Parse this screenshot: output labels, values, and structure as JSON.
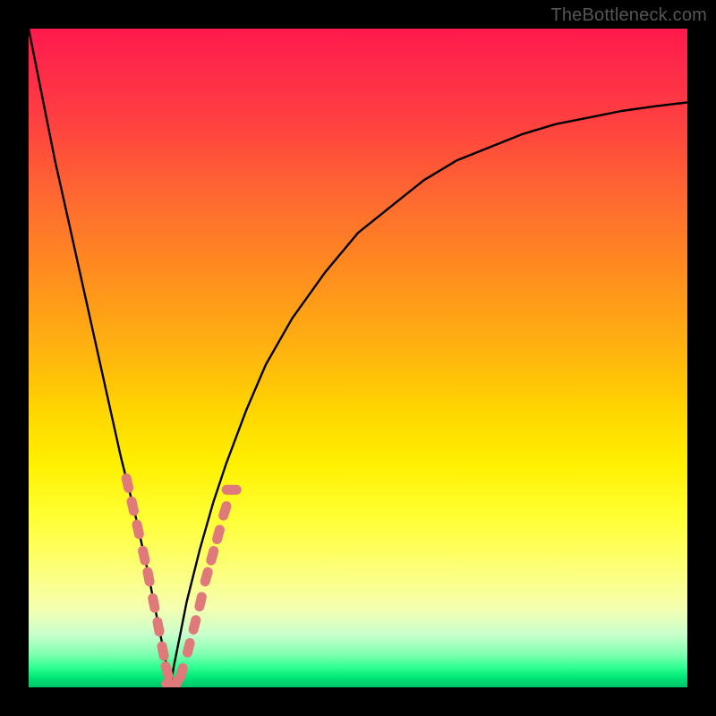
{
  "domain": "Chart",
  "watermark": "TheBottleneck.com",
  "colors": {
    "frame": "#000000",
    "curve_stroke": "#000000",
    "marker_fill": "#e07a7a",
    "gradient_stops": [
      "#ff1a4c",
      "#ff2a4a",
      "#ff4040",
      "#ff6a30",
      "#ff8a20",
      "#ffb010",
      "#ffd500",
      "#fff000",
      "#ffff33",
      "#ffff66",
      "#f5ffb0",
      "#c8ffcc",
      "#7fffb0",
      "#2dff8f",
      "#00e676",
      "#00c46a"
    ]
  },
  "chart_data": {
    "type": "line",
    "title": "",
    "xlabel": "",
    "ylabel": "",
    "xlim": [
      0,
      1
    ],
    "ylim": [
      0,
      1
    ],
    "note": "Values are normalized screen fractions (0..1). y represents the curve height from bottom; the visual color gradient encodes the same scalar (red high, green low). The minimum is at x≈0.215.",
    "series": [
      {
        "name": "bottleneck-curve",
        "x": [
          0.0,
          0.02,
          0.04,
          0.06,
          0.08,
          0.1,
          0.12,
          0.14,
          0.16,
          0.18,
          0.19,
          0.2,
          0.21,
          0.215,
          0.22,
          0.23,
          0.24,
          0.26,
          0.28,
          0.3,
          0.33,
          0.36,
          0.4,
          0.45,
          0.5,
          0.55,
          0.6,
          0.65,
          0.7,
          0.75,
          0.8,
          0.85,
          0.9,
          0.95,
          1.0
        ],
        "y": [
          1.0,
          0.9,
          0.8,
          0.71,
          0.62,
          0.53,
          0.44,
          0.35,
          0.27,
          0.18,
          0.13,
          0.08,
          0.03,
          0.0,
          0.03,
          0.08,
          0.13,
          0.21,
          0.28,
          0.34,
          0.42,
          0.49,
          0.56,
          0.63,
          0.69,
          0.73,
          0.77,
          0.8,
          0.82,
          0.84,
          0.855,
          0.865,
          0.875,
          0.882,
          0.888
        ]
      }
    ],
    "markers": {
      "name": "highlighted-points",
      "note": "Salmon pill-shaped markers clustered around the minimum on both branches.",
      "points": [
        {
          "x": 0.15,
          "y": 0.31
        },
        {
          "x": 0.158,
          "y": 0.275
        },
        {
          "x": 0.166,
          "y": 0.24
        },
        {
          "x": 0.175,
          "y": 0.2
        },
        {
          "x": 0.182,
          "y": 0.168
        },
        {
          "x": 0.19,
          "y": 0.128
        },
        {
          "x": 0.197,
          "y": 0.092
        },
        {
          "x": 0.204,
          "y": 0.055
        },
        {
          "x": 0.21,
          "y": 0.025
        },
        {
          "x": 0.216,
          "y": 0.005
        },
        {
          "x": 0.224,
          "y": 0.005
        },
        {
          "x": 0.232,
          "y": 0.022
        },
        {
          "x": 0.243,
          "y": 0.06
        },
        {
          "x": 0.252,
          "y": 0.095
        },
        {
          "x": 0.261,
          "y": 0.13
        },
        {
          "x": 0.27,
          "y": 0.168
        },
        {
          "x": 0.279,
          "y": 0.2
        },
        {
          "x": 0.288,
          "y": 0.232
        },
        {
          "x": 0.298,
          "y": 0.268
        },
        {
          "x": 0.308,
          "y": 0.3
        }
      ]
    }
  }
}
